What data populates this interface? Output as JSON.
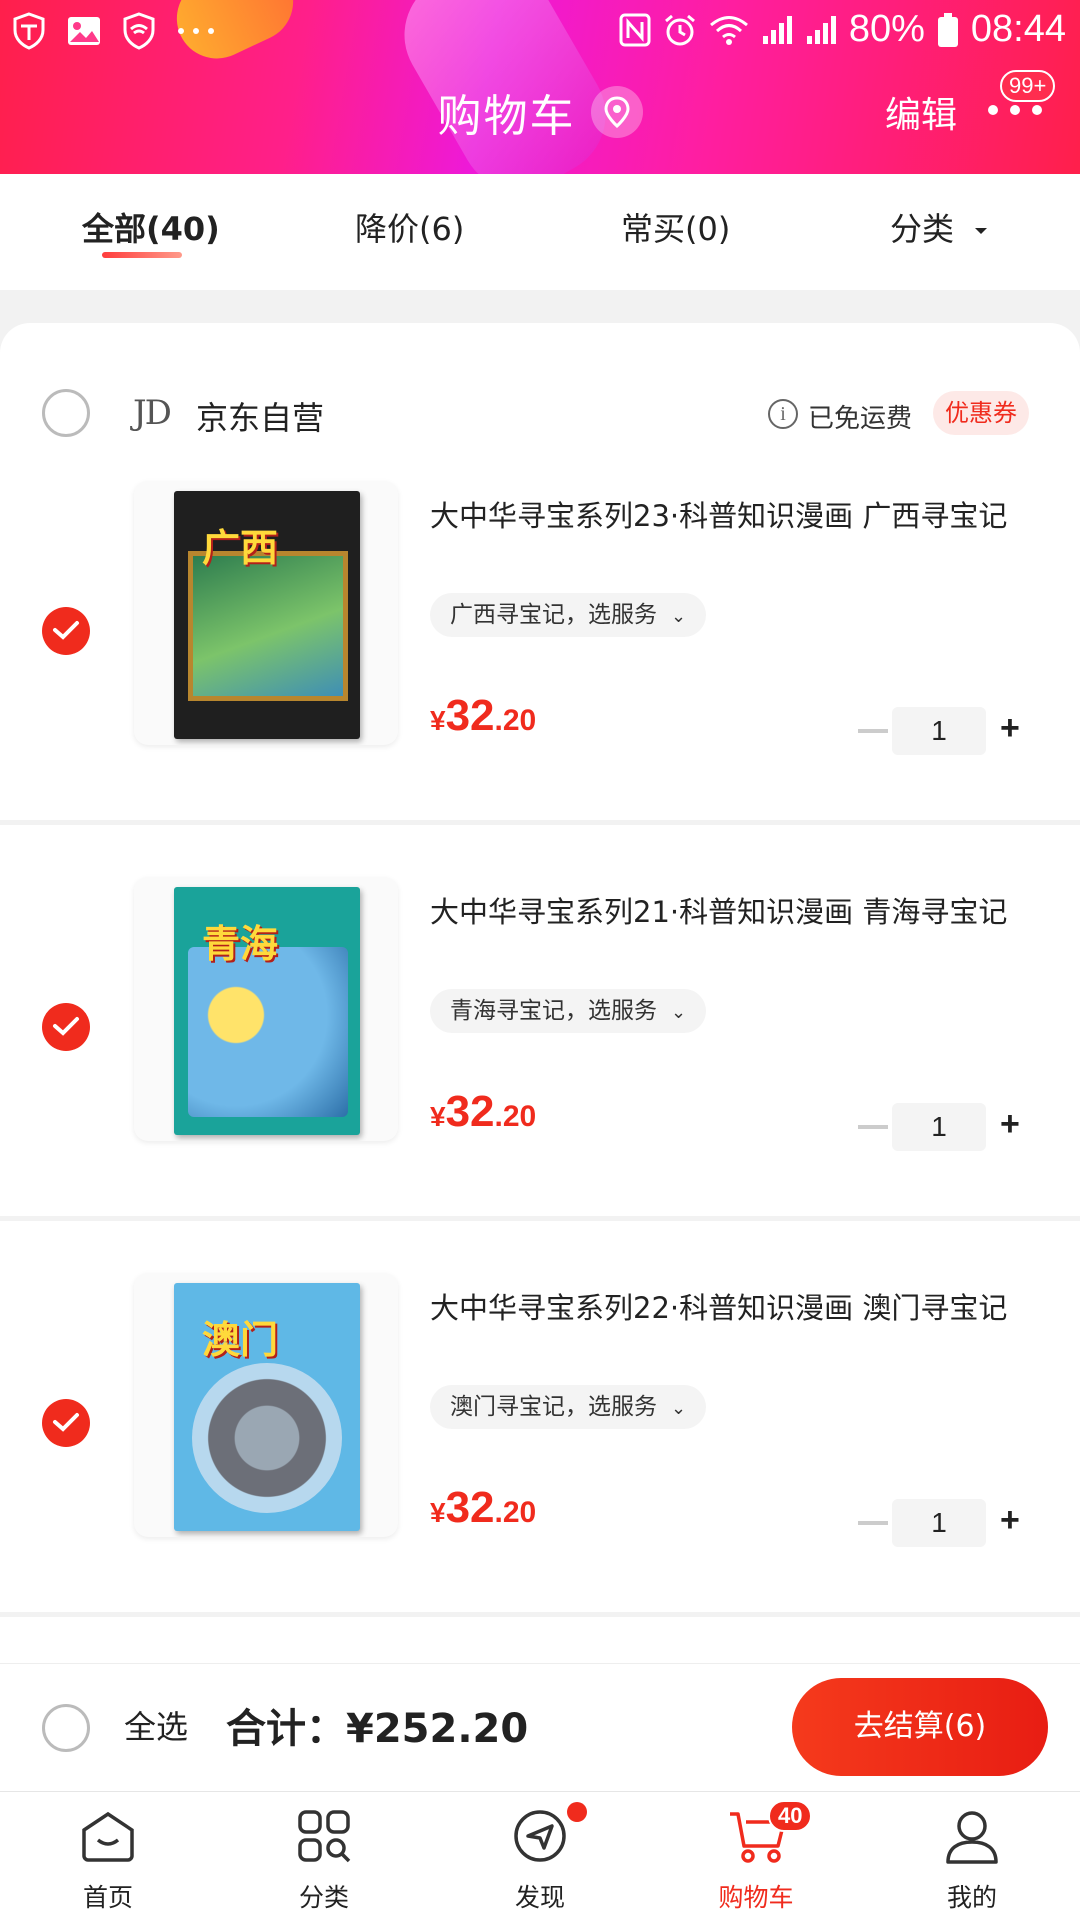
{
  "status_bar": {
    "battery": "80%",
    "time": "08:44",
    "network": "4G"
  },
  "header": {
    "title": "购物车",
    "edit_label": "编辑",
    "more_badge": "99+"
  },
  "tabs": [
    {
      "label": "全部(40)",
      "active": true
    },
    {
      "label": "降价(6)",
      "active": false
    },
    {
      "label": "常买(0)",
      "active": false
    },
    {
      "label": "分类",
      "active": false,
      "has_dropdown": true
    }
  ],
  "shop": {
    "logo_text": "JD",
    "name": "京东自营",
    "shipping_info": "已免运费",
    "coupon_label": "优惠券",
    "selected": false
  },
  "items": [
    {
      "title": "大中华寻宝系列23·科普知识漫画 广西寻宝记",
      "variant": "广西寻宝记，选服务",
      "price_currency": "¥",
      "price_int": "32",
      "price_dec": ".20",
      "quantity": "1",
      "selected": true,
      "cover_text": "广西",
      "cover_color": "#1f1f1f"
    },
    {
      "title": "大中华寻宝系列21·科普知识漫画 青海寻宝记",
      "variant": "青海寻宝记，选服务",
      "price_currency": "¥",
      "price_int": "32",
      "price_dec": ".20",
      "quantity": "1",
      "selected": true,
      "cover_text": "青海",
      "cover_color": "#1aa39a"
    },
    {
      "title": "大中华寻宝系列22·科普知识漫画 澳门寻宝记",
      "variant": "澳门寻宝记，选服务",
      "price_currency": "¥",
      "price_int": "32",
      "price_dec": ".20",
      "quantity": "1",
      "selected": true,
      "cover_text": "澳门",
      "cover_color": "#5fb8e6"
    }
  ],
  "checkout": {
    "select_all_label": "全选",
    "total_label": "合计：¥252.20",
    "button_label": "去结算(6)"
  },
  "bottom_nav": [
    {
      "label": "首页",
      "icon": "home-icon",
      "active": false
    },
    {
      "label": "分类",
      "icon": "category-icon",
      "active": false
    },
    {
      "label": "发现",
      "icon": "discover-icon",
      "active": false,
      "dot": true
    },
    {
      "label": "购物车",
      "icon": "cart-icon",
      "active": true,
      "badge": "40"
    },
    {
      "label": "我的",
      "icon": "profile-icon",
      "active": false
    }
  ],
  "colors": {
    "accent": "#f02b1d",
    "header_start": "#ff1f4b",
    "header_mid": "#ee19d8"
  }
}
